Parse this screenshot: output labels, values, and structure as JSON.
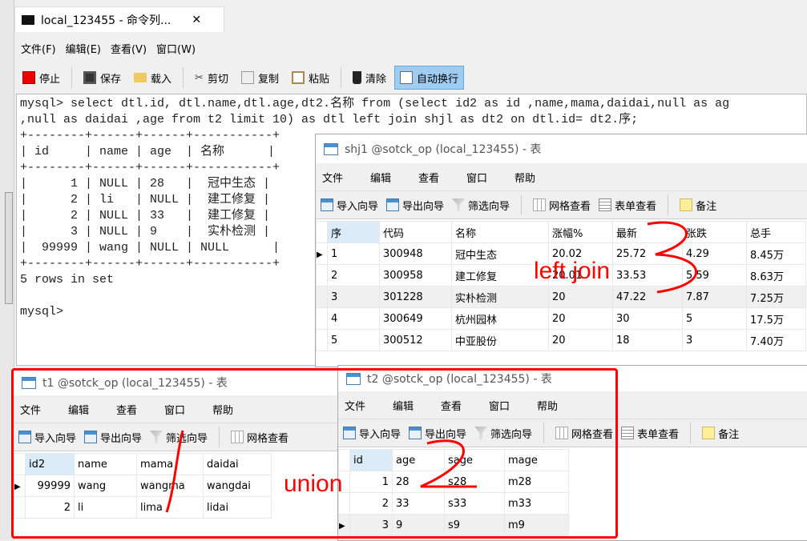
{
  "tab": {
    "title": "local_123455 - 命令列...",
    "close": "✕"
  },
  "menu": [
    "文件(F)",
    "编辑(E)",
    "查看(V)",
    "窗口(W)"
  ],
  "toolbar": [
    "停止",
    "保存",
    "载入",
    "剪切",
    "复制",
    "粘贴",
    "清除",
    "自动换行"
  ],
  "console": {
    "lines": [
      "mysql> select dtl.id, dtl.name,dtl.age,dt2.名称 from (select id2 as id ,name,mama,daidai,null as ag",
      ",null as daidai ,age from t2 limit 10) as dtl left join shjl as dt2 on dtl.id= dt2.序;",
      "+--------+------+------+-----------+",
      "| id     | name | age  | 名称      |",
      "+--------+------+------+-----------+",
      "|      1 | NULL | 28   |  冠中生态 |",
      "|      2 | li   | NULL |  建工修复 |",
      "|      2 | NULL | 33   |  建工修复 |",
      "|      3 | NULL | 9    |  实朴检测 |",
      "|  99999 | wang | NULL | NULL      |",
      "+--------+------+------+-----------+",
      "5 rows in set",
      "",
      "mysql>"
    ]
  },
  "win_menu": [
    "文件",
    "编辑",
    "查看",
    "窗口",
    "帮助"
  ],
  "win_toolbar": [
    "导入向导",
    "导出向导",
    "筛选向导",
    "网格查看",
    "表单查看",
    "备注"
  ],
  "shj1": {
    "title": "shj1 @sotck_op (local_123455) - 表",
    "columns": [
      "序",
      "代码",
      "名称",
      "涨幅%",
      "最新",
      "张跌",
      "总手"
    ],
    "rows": [
      [
        "1",
        "300948",
        "冠中生态",
        "20.02",
        "25.72",
        "4.29",
        "8.45万"
      ],
      [
        "2",
        "300958",
        "建工修复",
        "20.01",
        "33.53",
        "5.59",
        "8.63万"
      ],
      [
        "3",
        "301228",
        "实朴检测",
        "20",
        "47.22",
        "7.87",
        "7.25万"
      ],
      [
        "4",
        "300649",
        "杭州园林",
        "20",
        "30",
        "5",
        "17.5万"
      ],
      [
        "5",
        "300512",
        "中亚股份",
        "20",
        "18",
        "3",
        "7.40万"
      ]
    ]
  },
  "t1": {
    "title": "t1 @sotck_op (local_123455) - 表",
    "columns": [
      "id2",
      "name",
      "mama",
      "daidai"
    ],
    "rows": [
      [
        "99999",
        "wang",
        "wangma",
        "wangdai"
      ],
      [
        "2",
        "li",
        "lima",
        "lidai"
      ]
    ]
  },
  "t2": {
    "title": "t2 @sotck_op (local_123455) - 表",
    "columns": [
      "id",
      "age",
      "sage",
      "mage"
    ],
    "rows": [
      [
        "1",
        "28",
        "s28",
        "m28"
      ],
      [
        "2",
        "33",
        "s33",
        "m33"
      ],
      [
        "3",
        "9",
        "s9",
        "m9"
      ]
    ]
  },
  "annotations": {
    "left_join": "left join",
    "union": "union",
    "color": "#ff0000"
  }
}
